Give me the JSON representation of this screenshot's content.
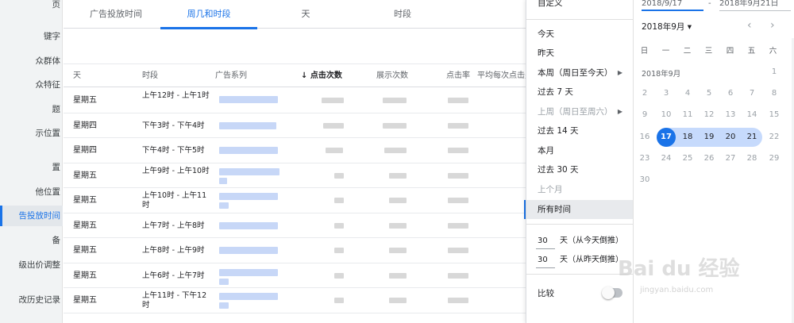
{
  "sidebar": {
    "items": [
      {
        "label": "页"
      },
      {
        "label": "键字"
      },
      {
        "label": "众群体"
      },
      {
        "label": "众特征"
      },
      {
        "label": "题"
      },
      {
        "label": "示位置"
      },
      {
        "label": "置"
      },
      {
        "label": "他位置"
      },
      {
        "label": "告投放时间"
      },
      {
        "label": "备"
      },
      {
        "label": "级出价调整"
      },
      {
        "label": "改历史记录"
      }
    ]
  },
  "tabs": [
    {
      "label": "广告投放时间"
    },
    {
      "label": "周几和时段"
    },
    {
      "label": "天"
    },
    {
      "label": "时段"
    }
  ],
  "table": {
    "columns": [
      "天",
      "时段",
      "广告系列",
      "点击次数",
      "展示次数",
      "点击率",
      "平均每次点击费用"
    ],
    "rows": [
      {
        "day": "星期五",
        "slot": "上午12时 - 上午1时"
      },
      {
        "day": "星期四",
        "slot": "下午3时 - 下午4时"
      },
      {
        "day": "星期四",
        "slot": "下午4时 - 下午5时"
      },
      {
        "day": "星期五",
        "slot": "上午9时 - 上午10时"
      },
      {
        "day": "星期五",
        "slot": "上午10时 - 上午11时"
      },
      {
        "day": "星期五",
        "slot": "上午7时 - 上午8时"
      },
      {
        "day": "星期五",
        "slot": "上午8时 - 上午9时"
      },
      {
        "day": "星期五",
        "slot": "上午6时 - 上午7时"
      },
      {
        "day": "星期五",
        "slot": "上午11时 - 下午12时"
      }
    ]
  },
  "menu": {
    "custom": "自定义",
    "items": [
      {
        "label": "今天"
      },
      {
        "label": "昨天"
      },
      {
        "label": "本周（周日至今天）"
      },
      {
        "label": "过去 7 天"
      },
      {
        "label": "上周（周日至周六）"
      },
      {
        "label": "过去 14 天"
      },
      {
        "label": "本月"
      },
      {
        "label": "过去 30 天"
      },
      {
        "label": "上个月"
      },
      {
        "label": "所有时间"
      }
    ],
    "days_from_today_value": "30",
    "days_from_today_label": "天（从今天倒推）",
    "days_from_yesterday_value": "30",
    "days_from_yesterday_label": "天（从昨天倒推）",
    "compare_label": "比较"
  },
  "calendar": {
    "start_date": "2018/9/17",
    "end_date": "2018年9月21日",
    "dash": "-",
    "month_selector": "2018年9月",
    "weekdays": [
      "日",
      "一",
      "二",
      "三",
      "四",
      "五",
      "六"
    ],
    "month_label": "2018年9月",
    "days": [
      "1",
      "2",
      "3",
      "4",
      "5",
      "6",
      "7",
      "8",
      "9",
      "10",
      "11",
      "12",
      "13",
      "14",
      "15",
      "16",
      "17",
      "18",
      "19",
      "20",
      "21",
      "22",
      "23",
      "24",
      "25",
      "26",
      "27",
      "28",
      "29",
      "30"
    ]
  },
  "watermark": {
    "text": "Bai du 经验",
    "sub": "jingyan.baidu.com"
  },
  "colors": {
    "accent": "#1a73e8",
    "range": "#c6dafc"
  }
}
